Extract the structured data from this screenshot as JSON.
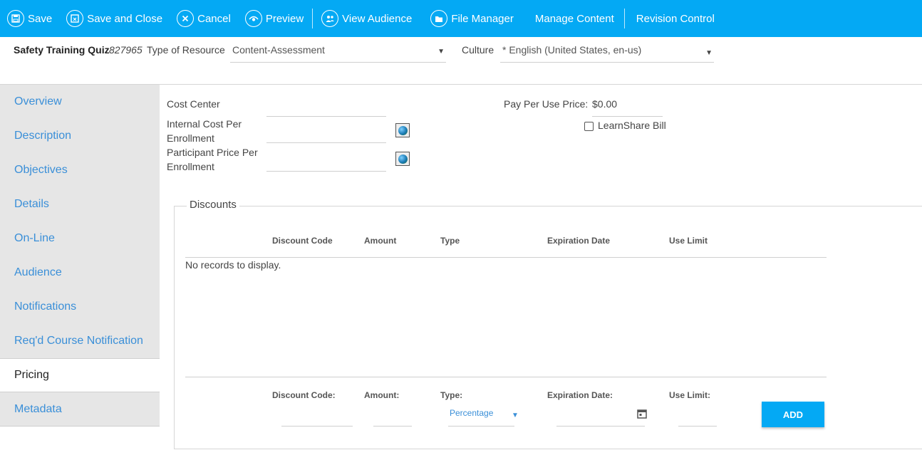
{
  "toolbar": {
    "save": "Save",
    "save_close": "Save and Close",
    "cancel": "Cancel",
    "preview": "Preview",
    "view_audience": "View Audience",
    "file_manager": "File Manager",
    "manage_content": "Manage Content",
    "revision_control": "Revision Control"
  },
  "header": {
    "title": "Safety Training Quiz",
    "resource_id": "827965",
    "type_label": "Type of Resource",
    "type_value": "Content-Assessment",
    "culture_label": "Culture",
    "culture_value": "* English (United States, en-us)"
  },
  "sidebar": {
    "items": [
      {
        "label": "Overview"
      },
      {
        "label": "Description"
      },
      {
        "label": "Objectives"
      },
      {
        "label": "Details"
      },
      {
        "label": "On-Line"
      },
      {
        "label": "Audience"
      },
      {
        "label": "Notifications"
      },
      {
        "label": "Req'd Course Notification"
      },
      {
        "label": "Pricing"
      },
      {
        "label": "Metadata"
      }
    ],
    "active": "Pricing"
  },
  "pricing": {
    "cost_center_label": "Cost Center",
    "internal_cost_label_1": "Internal Cost Per",
    "internal_cost_label_2": "Enrollment",
    "participant_price_label_1": "Participant Price Per",
    "participant_price_label_2": "Enrollment",
    "pay_per_use_label": "Pay Per Use Price:",
    "pay_per_use_value": "$0.00",
    "learnshare_bill_label": "LearnShare Bill"
  },
  "discounts": {
    "legend": "Discounts",
    "columns": [
      "Discount Code",
      "Amount",
      "Type",
      "Expiration Date",
      "Use Limit"
    ],
    "empty_message": "No records to display.",
    "form": {
      "code_label": "Discount Code:",
      "amount_label": "Amount:",
      "type_label": "Type:",
      "type_value": "Percentage",
      "expiration_label": "Expiration Date:",
      "use_limit_label": "Use Limit:",
      "add_label": "ADD"
    }
  }
}
